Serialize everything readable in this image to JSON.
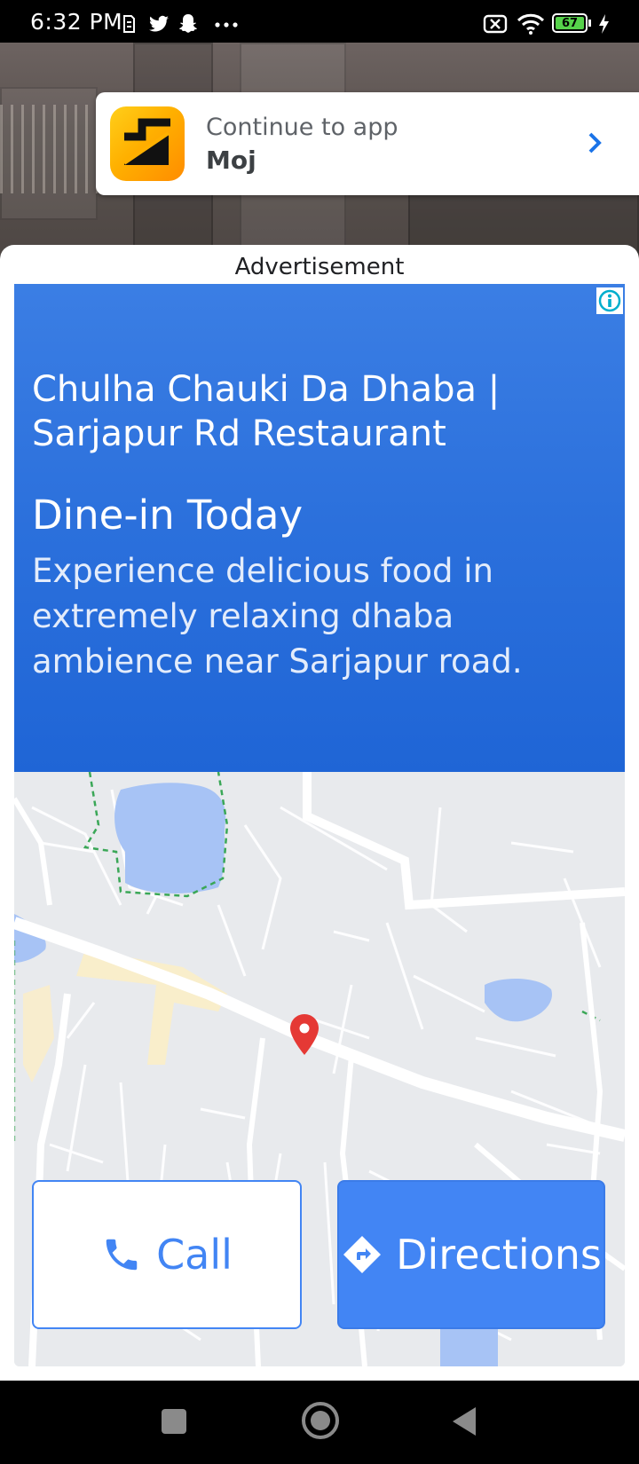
{
  "status_bar": {
    "time": "6:32 PM",
    "battery": "67",
    "icons": [
      "sim-icon",
      "twitter-icon",
      "snapchat-icon",
      "more-icon",
      "no-sim-icon",
      "wifi-icon",
      "battery-icon",
      "charging-icon"
    ]
  },
  "app_banner": {
    "continue_label": "Continue to app",
    "app_name": "Moj"
  },
  "ad": {
    "label": "Advertisement",
    "title": "Chulha Chauki Da Dhaba | Sarjapur Rd Restaurant",
    "headline": "Dine-in Today",
    "description": "Experience delicious food in extremely relaxing dhaba ambience near Sarjapur road.",
    "call_label": "Call",
    "directions_label": "Directions"
  },
  "colors": {
    "ad_blue": "#2b70dc",
    "button_blue": "#4285f4",
    "map_background": "#e8eaed",
    "map_water": "#a7c3f5",
    "map_marker": "#e53935"
  },
  "nav_bar": {
    "icons": [
      "recents-square-icon",
      "home-circle-icon",
      "back-triangle-icon"
    ]
  }
}
